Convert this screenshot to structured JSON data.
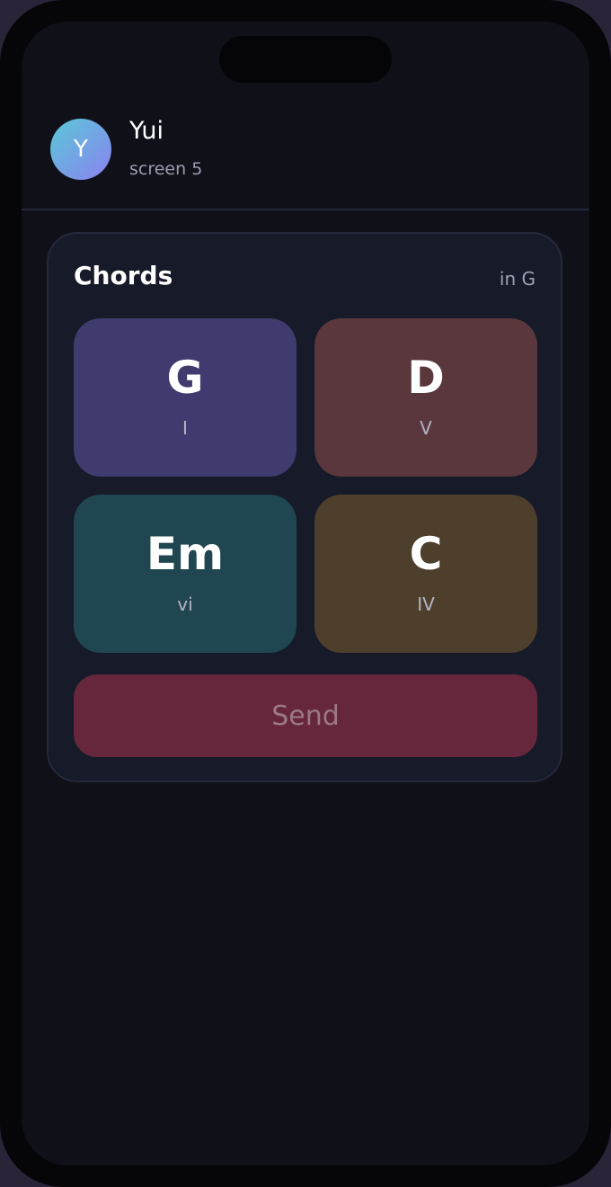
{
  "contact": {
    "initial": "Y",
    "name": "Yui",
    "subtitle": "screen 5"
  },
  "card": {
    "title": "Chords",
    "key_label": "in G",
    "chords": [
      {
        "name": "G",
        "numeral": "I",
        "color": "#3f3b6e"
      },
      {
        "name": "D",
        "numeral": "V",
        "color": "#5a373d"
      },
      {
        "name": "Em",
        "numeral": "vi",
        "color": "#1f4651"
      },
      {
        "name": "C",
        "numeral": "IV",
        "color": "#4d3f2c"
      }
    ],
    "send_label": "Send"
  },
  "colors": {
    "background": "#101118",
    "card": "#161a29",
    "send_button": "#66263b",
    "avatar_gradient_start": "#5ac8d8",
    "avatar_gradient_end": "#8b82f0"
  }
}
